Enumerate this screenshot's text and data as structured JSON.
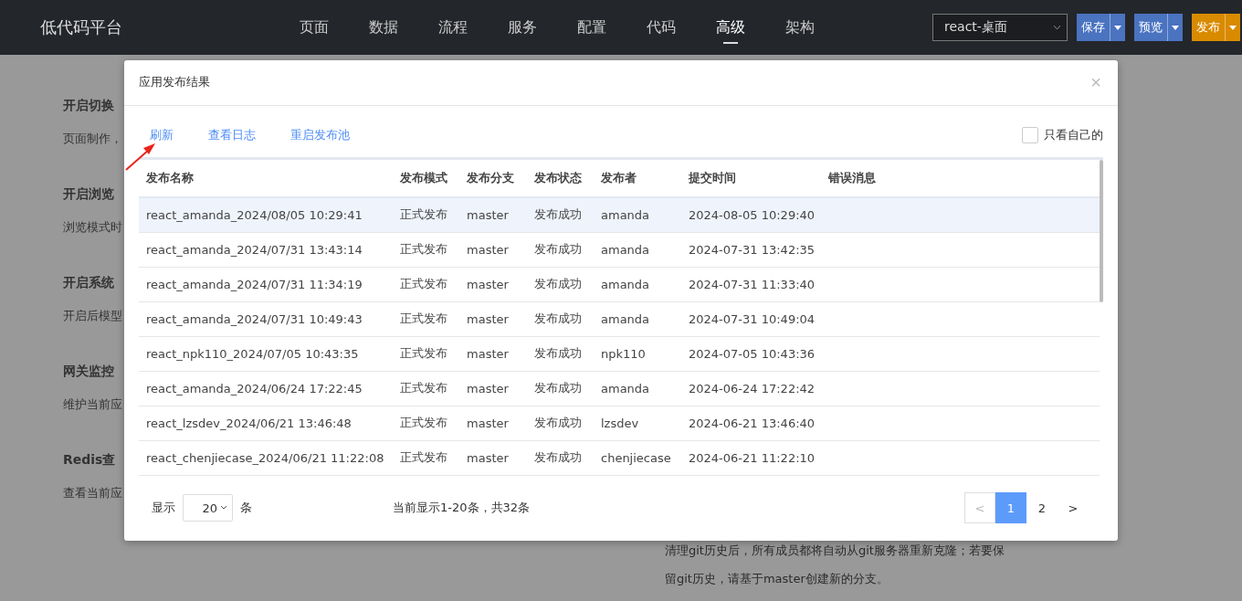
{
  "header": {
    "title": "低代码平台",
    "nav": [
      {
        "label": "页面",
        "selected": false
      },
      {
        "label": "数据",
        "selected": false
      },
      {
        "label": "流程",
        "selected": false
      },
      {
        "label": "服务",
        "selected": false
      },
      {
        "label": "配置",
        "selected": false
      },
      {
        "label": "代码",
        "selected": false
      },
      {
        "label": "高级",
        "selected": true
      },
      {
        "label": "架构",
        "selected": false
      }
    ],
    "target_select": {
      "value": "react-桌面"
    },
    "buttons": [
      {
        "label": "保存",
        "kind": "primary"
      },
      {
        "label": "预览",
        "kind": "primary"
      },
      {
        "label": "发布",
        "kind": "warning"
      }
    ]
  },
  "background_page": {
    "sections": [
      {
        "heading": "开启切换",
        "text": "页面制作，"
      },
      {
        "heading": "开启浏览",
        "text": "浏览模式时"
      },
      {
        "heading": "开启系统",
        "text": "开启后模型"
      },
      {
        "heading": "网关监控",
        "text": "维护当前应"
      },
      {
        "heading": "Redis查",
        "text": "查看当前应"
      }
    ],
    "note": "清理git历史后，所有成员都将自动从git服务器重新克隆；若要保留git历史，请基于master创建新的分支。"
  },
  "dialog": {
    "title": "应用发布结果",
    "close": "×",
    "actions": [
      "刷新",
      "查看日志",
      "重启发布池"
    ],
    "only_mine": {
      "label": "只看自己的",
      "checked": false
    },
    "table": {
      "columns": [
        "发布名称",
        "发布模式",
        "发布分支",
        "发布状态",
        "发布者",
        "提交时间",
        "错误消息"
      ],
      "rows": [
        {
          "selected": true,
          "cells": [
            "react_amanda_2024/08/05 10:29:41",
            "正式发布",
            "master",
            "发布成功",
            "amanda",
            "2024-08-05 10:29:40",
            ""
          ]
        },
        {
          "selected": false,
          "cells": [
            "react_amanda_2024/07/31 13:43:14",
            "正式发布",
            "master",
            "发布成功",
            "amanda",
            "2024-07-31 13:42:35",
            ""
          ]
        },
        {
          "selected": false,
          "cells": [
            "react_amanda_2024/07/31 11:34:19",
            "正式发布",
            "master",
            "发布成功",
            "amanda",
            "2024-07-31 11:33:40",
            ""
          ]
        },
        {
          "selected": false,
          "cells": [
            "react_amanda_2024/07/31 10:49:43",
            "正式发布",
            "master",
            "发布成功",
            "amanda",
            "2024-07-31 10:49:04",
            ""
          ]
        },
        {
          "selected": false,
          "cells": [
            "react_npk110_2024/07/05 10:43:35",
            "正式发布",
            "master",
            "发布成功",
            "npk110",
            "2024-07-05 10:43:36",
            ""
          ]
        },
        {
          "selected": false,
          "cells": [
            "react_amanda_2024/06/24 17:22:45",
            "正式发布",
            "master",
            "发布成功",
            "amanda",
            "2024-06-24 17:22:42",
            ""
          ]
        },
        {
          "selected": false,
          "cells": [
            "react_lzsdev_2024/06/21 13:46:48",
            "正式发布",
            "master",
            "发布成功",
            "lzsdev",
            "2024-06-21 13:46:40",
            ""
          ]
        },
        {
          "selected": false,
          "cells": [
            "react_chenjiecase_2024/06/21 11:22:08",
            "正式发布",
            "master",
            "发布成功",
            "chenjiecase",
            "2024-06-21 11:22:10",
            ""
          ]
        }
      ]
    },
    "footer": {
      "show_label": "显示",
      "page_size": "20",
      "unit": "条",
      "summary": "当前显示1-20条，共32条",
      "pages": [
        {
          "label": "<",
          "kind": "prev",
          "disabled": true,
          "selected": false
        },
        {
          "label": "1",
          "kind": "page",
          "disabled": false,
          "selected": true
        },
        {
          "label": "2",
          "kind": "page",
          "disabled": false,
          "selected": false
        },
        {
          "label": ">",
          "kind": "next",
          "disabled": false,
          "selected": false
        }
      ]
    }
  }
}
